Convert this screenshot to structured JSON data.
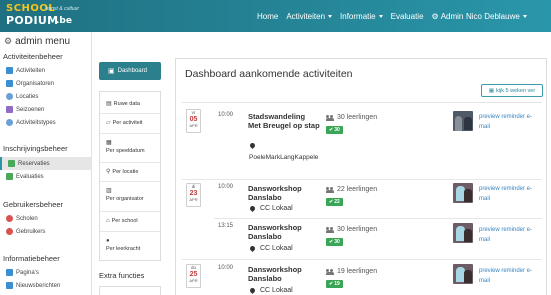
{
  "navbar": {
    "logo": {
      "school": "SCHOOL",
      "podium": "PODIUM",
      "be": ".be",
      "tag": "kunst & cultuur"
    },
    "links": [
      {
        "label": "Home",
        "caret": false
      },
      {
        "label": "Activiteiten",
        "caret": true
      },
      {
        "label": "Informatie",
        "caret": true
      },
      {
        "label": "Evaluatie",
        "caret": false
      },
      {
        "label": "Admin",
        "caret": false,
        "icon": "gear-icon"
      }
    ],
    "user": "Nico Deblauwe"
  },
  "sidebar": {
    "title": "admin menu",
    "sections": [
      {
        "heading": "Activiteitenbeheer",
        "items": [
          "Activiteiten",
          "Organisatoren",
          "Locaties",
          "Seizoenen",
          "Activiteitstypes"
        ]
      },
      {
        "heading": "Inschrijvingsbeheer",
        "items": [
          "Reservaties",
          "Evaluaties"
        ]
      },
      {
        "heading": "Gebruikersbeheer",
        "items": [
          "Scholen",
          "Gebruikers"
        ]
      },
      {
        "heading": "Informatiebeheer",
        "items": [
          "Pagina's",
          "Nieuwsberichten"
        ]
      }
    ],
    "active_item": "Reservaties"
  },
  "middle": {
    "dashboard_label": "Dashboard",
    "items": [
      "Ruwe data",
      "Per activiteit",
      "Per speeldatum",
      "Per locatie",
      "Per organisator",
      "Per school",
      "Per leerkracht"
    ],
    "extra_heading": "Extra functies"
  },
  "main": {
    "title": "Dashboard aankomende activiteiten",
    "weeks_button": "kijk 5 weken ver",
    "dates": [
      {
        "weekday": "vr",
        "day": "05",
        "month": "APR"
      },
      {
        "weekday": "di",
        "day": "23",
        "month": "APR"
      },
      {
        "weekday": "do",
        "day": "25",
        "month": "APR"
      }
    ],
    "activities": [
      {
        "time": "10:00",
        "title": "Stadswandeling Met Breugel op stap",
        "location": "PoeleMarkLangKappele",
        "students": "30 leerlingen",
        "badge": "30",
        "preview": "preview reminder e-mail"
      },
      {
        "time": "10:00",
        "title": "Dansworkshop Danslabo",
        "location": "CC Lokaal",
        "students": "22 leerlingen",
        "badge": "22",
        "preview": "preview reminder e-mail"
      },
      {
        "time": "13:15",
        "title": "Dansworkshop Danslabo",
        "location": "CC Lokaal",
        "students": "30 leerlingen",
        "badge": "30",
        "preview": "preview reminder e-mail"
      },
      {
        "time": "10:00",
        "title": "Dansworkshop Danslabo",
        "location": "CC Lokaal",
        "students": "19 leerlingen",
        "badge": "19",
        "preview": "preview reminder e-mail"
      }
    ]
  }
}
